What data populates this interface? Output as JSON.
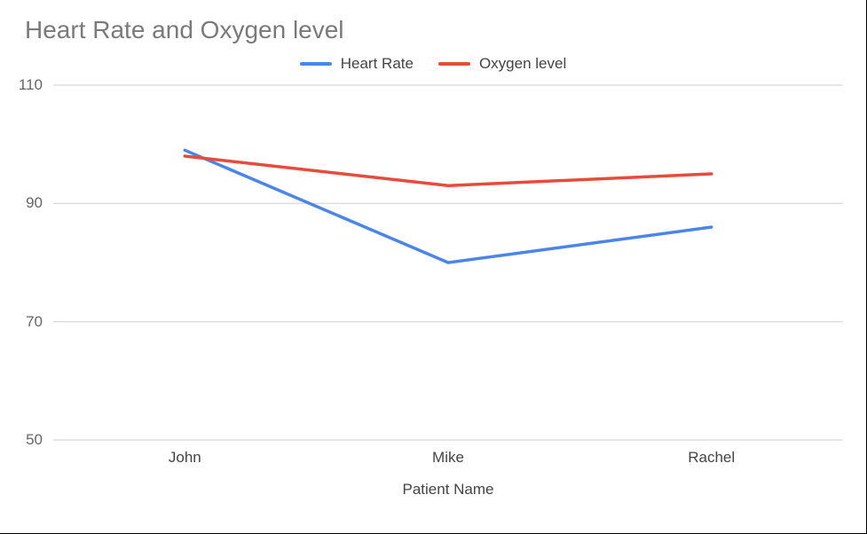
{
  "title": "Heart Rate and Oxygen level",
  "legend": {
    "heart_rate": "Heart Rate",
    "oxygen_level": "Oxygen level"
  },
  "xaxis": {
    "title": "Patient Name",
    "categories": [
      "John",
      "Mike",
      "Rachel"
    ]
  },
  "yaxis": {
    "ticks": [
      50,
      70,
      90,
      110
    ]
  },
  "colors": {
    "heart_rate": "#4a86e8",
    "oxygen_level": "#e64c3c"
  },
  "chart_data": {
    "type": "line",
    "title": "Heart Rate and Oxygen level",
    "xlabel": "Patient Name",
    "ylabel": "",
    "ylim": [
      50,
      110
    ],
    "categories": [
      "John",
      "Mike",
      "Rachel"
    ],
    "series": [
      {
        "name": "Heart Rate",
        "values": [
          99,
          80,
          86
        ]
      },
      {
        "name": "Oxygen level",
        "values": [
          98,
          93,
          95
        ]
      }
    ]
  }
}
